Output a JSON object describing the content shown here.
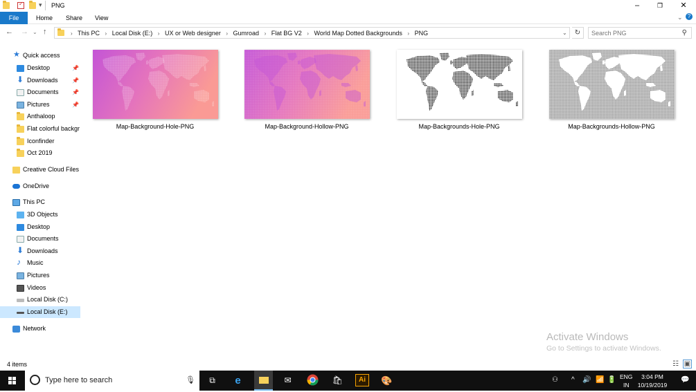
{
  "window": {
    "title": "PNG"
  },
  "ribbon": {
    "tabs": [
      "File",
      "Home",
      "Share",
      "View"
    ]
  },
  "address": {
    "crumbs": [
      "This PC",
      "Local Disk (E:)",
      "UX or Web designer",
      "Gumroad",
      "Flat BG V2",
      "World Map Dotted Backgrounds",
      "PNG"
    ]
  },
  "search": {
    "placeholder": "Search PNG"
  },
  "nav": {
    "quick_access": "Quick access",
    "quick_items": [
      "Desktop",
      "Downloads",
      "Documents",
      "Pictures",
      "Anthaloop",
      "Flat colorful backgr",
      "Iconfinder",
      "Oct 2019"
    ],
    "creative_cloud": "Creative Cloud Files",
    "onedrive": "OneDrive",
    "this_pc": "This PC",
    "pc_items": [
      "3D Objects",
      "Desktop",
      "Documents",
      "Downloads",
      "Music",
      "Pictures",
      "Videos",
      "Local Disk (C:)",
      "Local Disk (E:)"
    ],
    "network": "Network"
  },
  "files": [
    {
      "name": "Map-Background-Hole-PNG"
    },
    {
      "name": "Map-Background-Hollow-PNG"
    },
    {
      "name": "Map-Backgrounds-Hole-PNG"
    },
    {
      "name": "Map-Backgrounds-Hollow-PNG"
    }
  ],
  "status": {
    "count": "4 items"
  },
  "watermark": {
    "title": "Activate Windows",
    "subtitle": "Go to Settings to activate Windows."
  },
  "taskbar": {
    "search_placeholder": "Type here to search",
    "lang_top": "ENG",
    "lang_bottom": "IN",
    "time": "3:04 PM",
    "date": "10/19/2019",
    "ai_label": "Ai"
  },
  "colors": {
    "accent": "#1979ca",
    "gradient_start": "#c455d6",
    "gradient_end": "#fa9a95"
  }
}
